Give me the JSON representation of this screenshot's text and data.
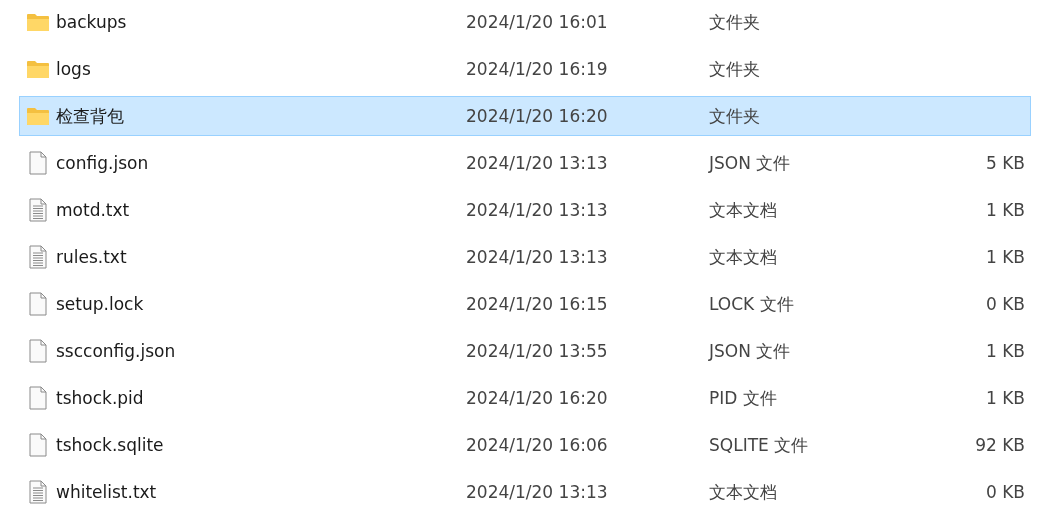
{
  "files": [
    {
      "kind": "folder",
      "name": "backups",
      "modified": "2024/1/20 16:01",
      "type": "文件夹",
      "selected": false
    },
    {
      "kind": "folder",
      "name": "logs",
      "modified": "2024/1/20 16:19",
      "type": "文件夹",
      "selected": false
    },
    {
      "kind": "folder",
      "name": "检查背包",
      "modified": "2024/1/20 16:20",
      "type": "文件夹",
      "selected": true
    },
    {
      "kind": "file",
      "name": "config.json",
      "modified": "2024/1/20 13:13",
      "type": "JSON 文件",
      "size": "5 KB",
      "selected": false
    },
    {
      "kind": "text",
      "name": "motd.txt",
      "modified": "2024/1/20 13:13",
      "type": "文本文档",
      "size": "1 KB",
      "selected": false
    },
    {
      "kind": "text",
      "name": "rules.txt",
      "modified": "2024/1/20 13:13",
      "type": "文本文档",
      "size": "1 KB",
      "selected": false
    },
    {
      "kind": "file",
      "name": "setup.lock",
      "modified": "2024/1/20 16:15",
      "type": "LOCK 文件",
      "size": "0 KB",
      "selected": false
    },
    {
      "kind": "file",
      "name": "sscconfig.json",
      "modified": "2024/1/20 13:55",
      "type": "JSON 文件",
      "size": "1 KB",
      "selected": false
    },
    {
      "kind": "file",
      "name": "tshock.pid",
      "modified": "2024/1/20 16:20",
      "type": "PID 文件",
      "size": "1 KB",
      "selected": false
    },
    {
      "kind": "file",
      "name": "tshock.sqlite",
      "modified": "2024/1/20 16:06",
      "type": "SQLITE 文件",
      "size": "92 KB",
      "selected": false
    },
    {
      "kind": "text",
      "name": "whitelist.txt",
      "modified": "2024/1/20 13:13",
      "type": "文本文档",
      "size": "0 KB",
      "selected": false
    }
  ]
}
